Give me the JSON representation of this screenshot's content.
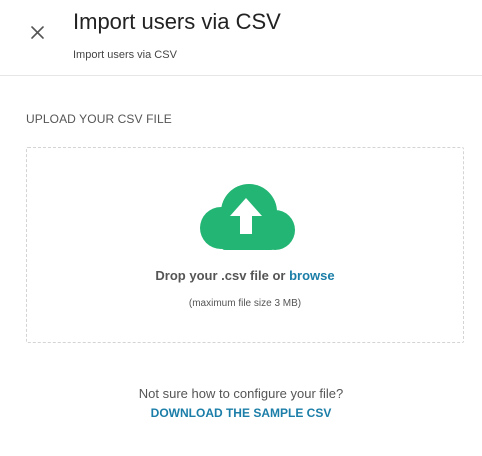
{
  "header": {
    "title": "Import users via CSV",
    "subtitle": "Import users via CSV",
    "close_icon": "close-icon"
  },
  "upload": {
    "section_label": "UPLOAD YOUR CSV FILE",
    "icon": "cloud-upload-icon",
    "drop_text": "Drop your .csv file or",
    "browse_label": "browse",
    "size_note": "(maximum file size 3 MB)"
  },
  "help": {
    "question": "Not sure how to configure your file?",
    "download_label": "DOWNLOAD THE SAMPLE CSV"
  },
  "colors": {
    "accent_link": "#1b7ea8",
    "cloud_green": "#22b573",
    "text": "#555555"
  }
}
